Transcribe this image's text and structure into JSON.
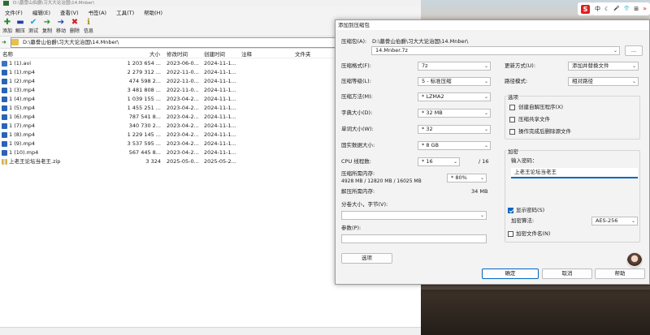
{
  "file_manager": {
    "title": "D:\\墓誊山伯爵\\习大大论治国\\14.Mnber\\",
    "menu": [
      "文件(F)",
      "编辑(E)",
      "查看(V)",
      "书签(A)",
      "工具(T)",
      "帮助(H)"
    ],
    "toolbar": [
      {
        "label": "添加",
        "icon": "plus-icon",
        "color": "#1f8f2a"
      },
      {
        "label": "解压",
        "icon": "minus-icon",
        "color": "#1f3fa6"
      },
      {
        "label": "测试",
        "icon": "check-icon",
        "color": "#18a2c8"
      },
      {
        "label": "复制",
        "icon": "copy-arrow-icon",
        "color": "#1f8f2a"
      },
      {
        "label": "移动",
        "icon": "move-arrow-icon",
        "color": "#1f3fa6"
      },
      {
        "label": "删除",
        "icon": "delete-x-icon",
        "color": "#d02020"
      },
      {
        "label": "信息",
        "icon": "info-icon",
        "color": "#b08a20"
      }
    ],
    "path": "D:\\墓誊山伯爵\\习大大论治国\\14.Mnber\\",
    "columns": [
      "名称",
      "大小",
      "修改时间",
      "创建时间",
      "注释",
      "文件夹"
    ],
    "files": [
      {
        "name": "1 (1).avi",
        "size": "1 203 654 ...",
        "modified": "2023-06-0...",
        "created": "2024-11-1...",
        "type": "avi"
      },
      {
        "name": "1 (1).mp4",
        "size": "2 279 312 ...",
        "modified": "2022-11-0...",
        "created": "2024-11-1...",
        "type": "mp4"
      },
      {
        "name": "1 (2).mp4",
        "size": "474 598 2...",
        "modified": "2022-11-0...",
        "created": "2024-11-1...",
        "type": "mp4"
      },
      {
        "name": "1 (3).mp4",
        "size": "3 481 808 ...",
        "modified": "2022-11-0...",
        "created": "2024-11-1...",
        "type": "mp4"
      },
      {
        "name": "1 (4).mp4",
        "size": "1 039 155 ...",
        "modified": "2023-04-2...",
        "created": "2024-11-1...",
        "type": "mp4"
      },
      {
        "name": "1 (5).mp4",
        "size": "1 455 251 ...",
        "modified": "2023-04-2...",
        "created": "2024-11-1...",
        "type": "mp4"
      },
      {
        "name": "1 (6).mp4",
        "size": "787 541 8...",
        "modified": "2023-04-2...",
        "created": "2024-11-1...",
        "type": "mp4"
      },
      {
        "name": "1 (7).mp4",
        "size": "340 730 2...",
        "modified": "2023-04-2...",
        "created": "2024-11-1...",
        "type": "mp4"
      },
      {
        "name": "1 (8).mp4",
        "size": "1 229 145 ...",
        "modified": "2023-04-2...",
        "created": "2024-11-1...",
        "type": "mp4"
      },
      {
        "name": "1 (9).mp4",
        "size": "3 537 595 ...",
        "modified": "2023-04-2...",
        "created": "2024-11-1...",
        "type": "mp4"
      },
      {
        "name": "1 (10).mp4",
        "size": "567 445 8...",
        "modified": "2023-04-2...",
        "created": "2024-11-1...",
        "type": "mp4"
      },
      {
        "name": "上老王论坛当老王.zip",
        "size": "3 324",
        "modified": "2025-05-0...",
        "created": "2025-05-2...",
        "type": "zip"
      }
    ]
  },
  "dialog": {
    "title": "添加到压缩包",
    "archive_label": "压缩包(A):",
    "archive_dir": "D:\\墓誊山伯爵\\习大大论治国\\14.Mnber\\",
    "archive_name": "14.Mnber.7z",
    "browse": "...",
    "format_label": "压缩格式(F):",
    "format": "7z",
    "level_label": "压缩等级(L):",
    "level": "5 - 标准压缩",
    "method_label": "压缩方法(M):",
    "method": "* LZMA2",
    "dict_label": "字典大小(D):",
    "dict": "* 32 MB",
    "word_label": "单词大小(W):",
    "word": "* 32",
    "solid_label": "固实数据大小:",
    "solid": "* 8 GB",
    "threads_label": "CPU 线程数:",
    "threads": "* 16",
    "threads_max": "/ 16",
    "mem_label": "压缩所需内存:",
    "mem_detail": "4928 MB / 12820 MB / 16025 MB",
    "mem_pct": "* 80%",
    "demem_label": "解压所需内存:",
    "demem": "34 MB",
    "split_label": "分卷大小，字节(V):",
    "params_label": "参数(P):",
    "options_btn": "选项",
    "update_label": "更新方式(U):",
    "update": "添加并替换文件",
    "pathmode_label": "路径模式:",
    "pathmode": "相对路径",
    "options_group": "选项",
    "opt_sfx": "创建自解压程序(X)",
    "opt_shared": "压缩共享文件",
    "opt_delete": "操作完成后删除源文件",
    "encrypt_group": "加密",
    "pwd_label": "输入密码：",
    "pwd_value": "上老王论坛当老王",
    "show_pwd": "显示密码(S)",
    "enc_method_label": "加密算法:",
    "enc_method": "AES-256",
    "enc_names": "加密文件名(N)",
    "ok": "确定",
    "cancel": "取消",
    "help": "帮助"
  },
  "tray": {
    "ime": "中",
    "moon": "☾",
    "mic": "🎤",
    "shirt": "👕",
    "grid": "⊞",
    "chev": "»",
    "brand_color": "#e02020"
  }
}
